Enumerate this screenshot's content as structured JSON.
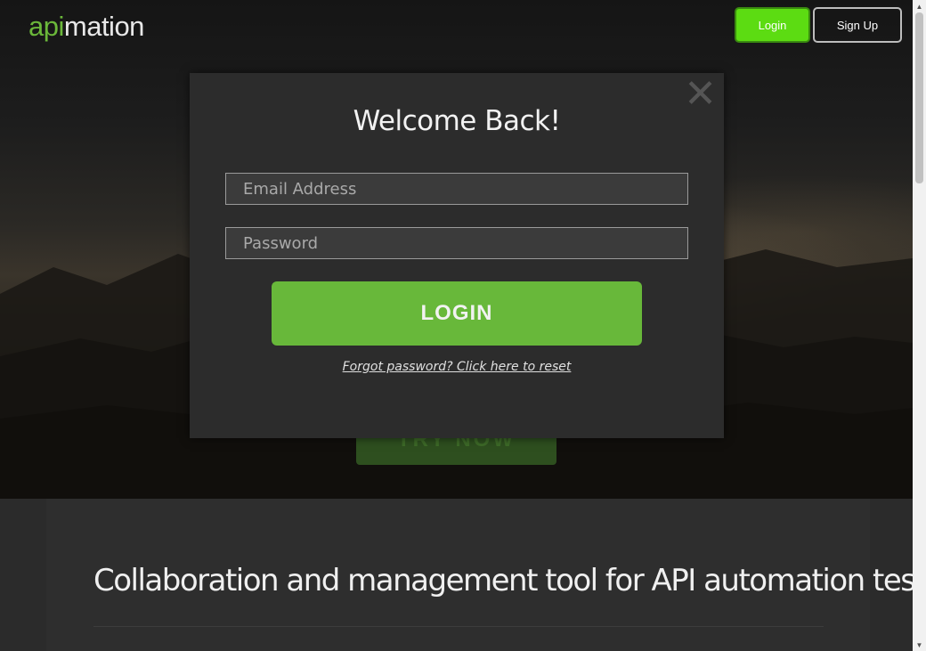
{
  "header": {
    "logo_api": "api",
    "logo_rest": "mation",
    "login_label": "Login",
    "signup_label": "Sign Up"
  },
  "hero": {
    "cta_label": "TRY NOW"
  },
  "modal": {
    "close_glyph": "✕",
    "title": "Welcome Back!",
    "email_placeholder": "Email Address",
    "password_placeholder": "Password",
    "login_button": "LOGIN",
    "forgot_link": "Forgot password? Click here to reset"
  },
  "content": {
    "tagline": "Collaboration and management tool for API automation tests"
  },
  "scrollbar": {
    "up_glyph": "▲",
    "down_glyph": "▼"
  },
  "colors": {
    "brand_green": "#6bb83a",
    "login_button_green": "#5cdc12",
    "modal_background": "#2c2c2c"
  }
}
